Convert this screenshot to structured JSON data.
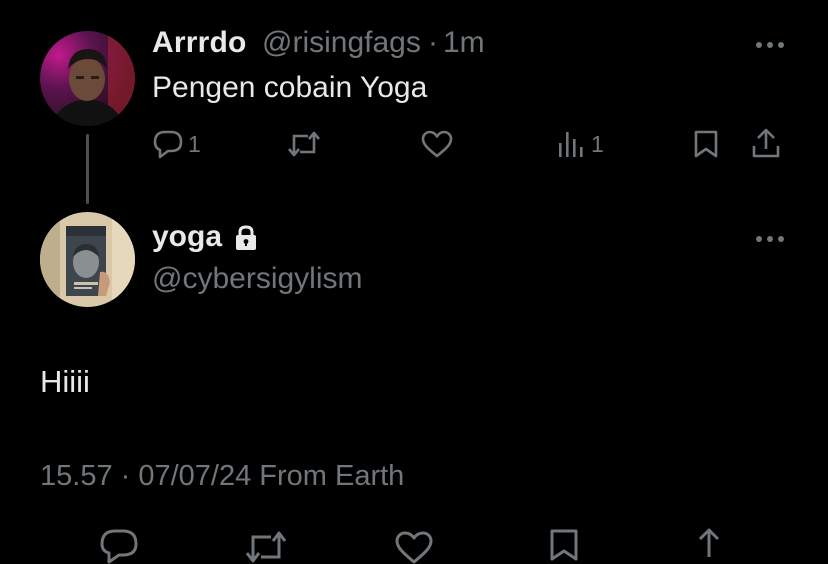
{
  "parent_tweet": {
    "author_name": "Arrrdo",
    "author_handle": "@risingfags",
    "separator": "·",
    "time": "1m",
    "text": "Pengen cobain Yoga",
    "actions": {
      "reply_count": "1",
      "views_count": "1"
    }
  },
  "reply_tweet": {
    "author_name": "yoga",
    "author_handle": "@cybersigylism",
    "text": "Hiiii",
    "meta": "15.57 · 07/07/24 From Earth"
  },
  "icons": [
    "more-icon",
    "reply-icon",
    "retweet-icon",
    "like-icon",
    "views-icon",
    "bookmark-icon",
    "share-icon",
    "lock-icon"
  ],
  "colors": {
    "background": "#000000",
    "primary_text": "#e7e9ea",
    "secondary_text": "#71767b",
    "thread_line": "#4a4f54"
  }
}
